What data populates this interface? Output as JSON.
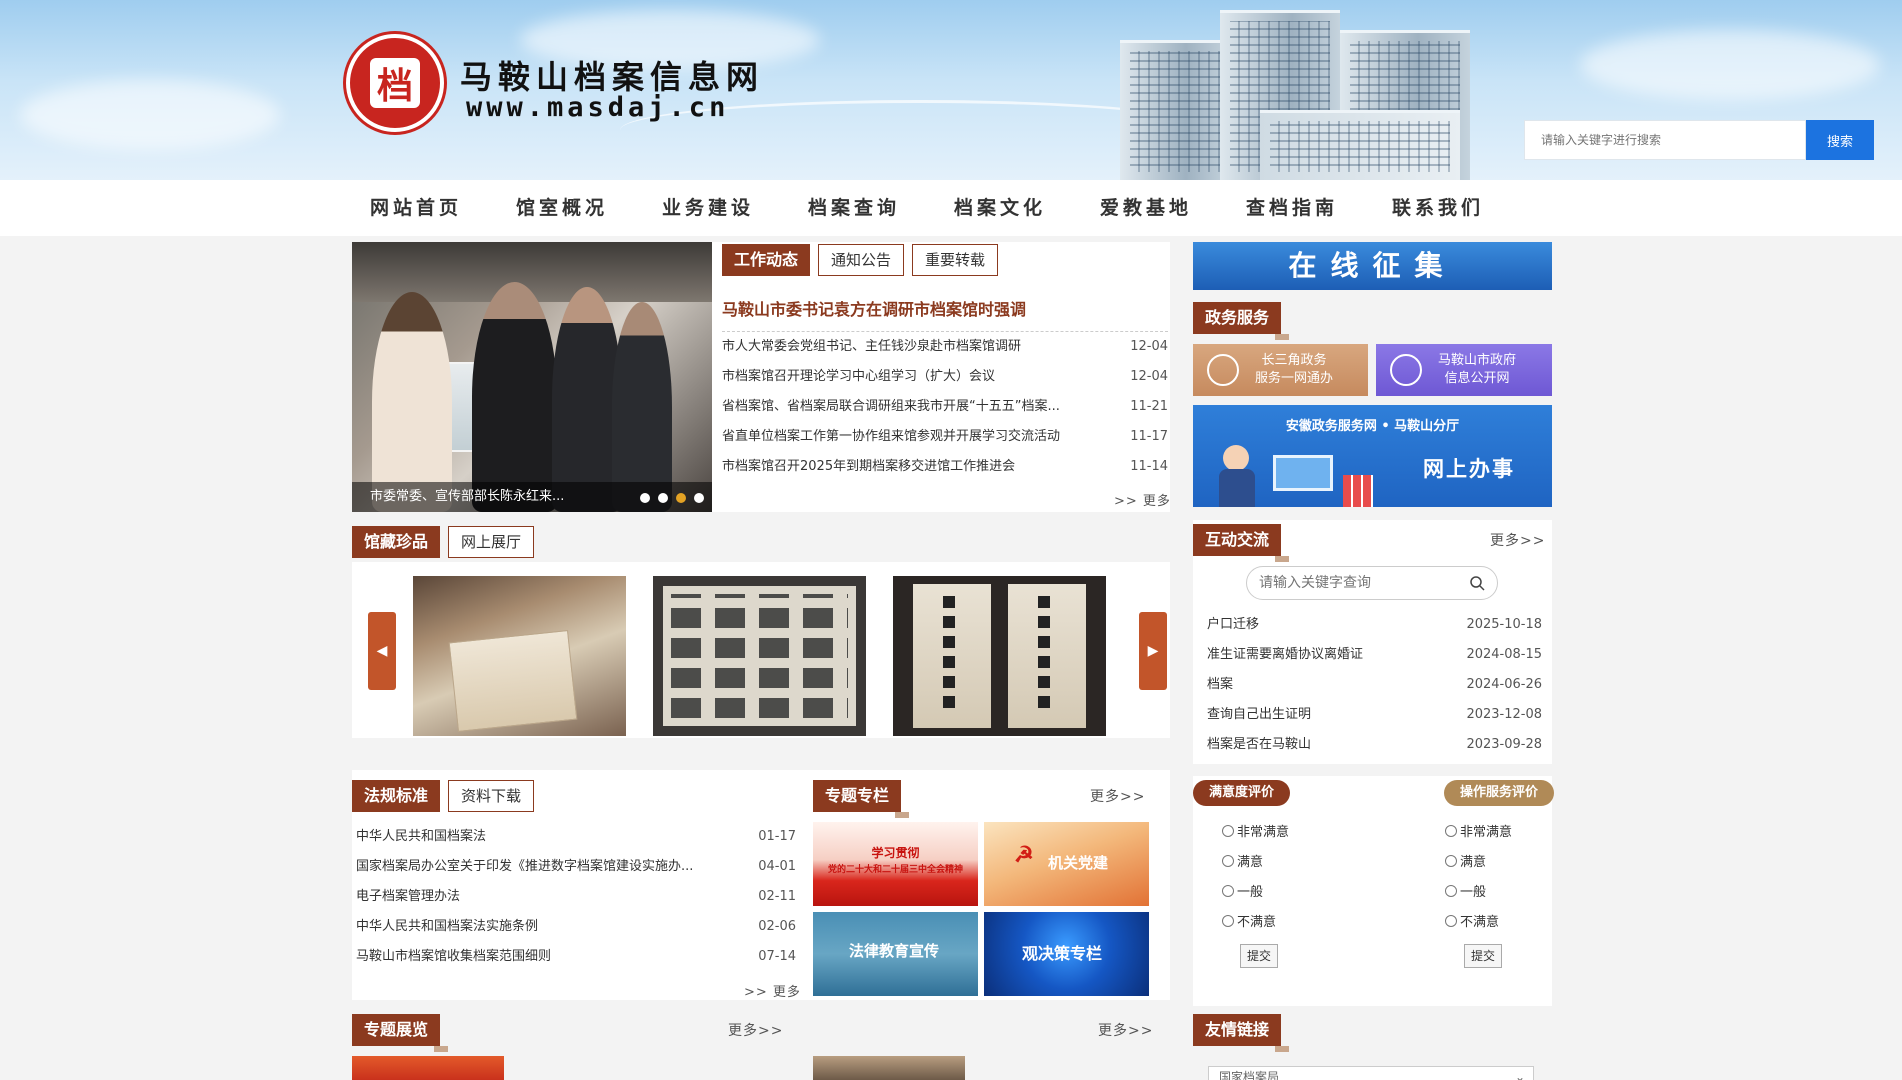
{
  "header": {
    "logo_char": "档",
    "site_title": "马鞍山档案信息网",
    "site_url": "www.masdaj.cn",
    "search_placeholder": "请输入关键字进行搜索",
    "search_button": "搜索"
  },
  "nav": [
    "网站首页",
    "馆室概况",
    "业务建设",
    "档案查询",
    "档案文化",
    "爱教基地",
    "查档指南",
    "联系我们"
  ],
  "carousel": {
    "caption": "市委常委、宣传部部长陈永红来...",
    "dot_count": 4,
    "active_dot": 3
  },
  "news": {
    "tabs": [
      "工作动态",
      "通知公告",
      "重要转载"
    ],
    "headline": "马鞍山市委书记袁方在调研市档案馆时强调",
    "items": [
      {
        "title": "市人大常委会党组书记、主任钱沙泉赴市档案馆调研",
        "date": "12-04"
      },
      {
        "title": "市档案馆召开理论学习中心组学习（扩大）会议",
        "date": "12-04"
      },
      {
        "title": "省档案馆、省档案局联合调研组来我市开展“十五五”档案...",
        "date": "11-21"
      },
      {
        "title": "省直单位档案工作第一协作组来馆参观并开展学习交流活动",
        "date": "11-17"
      },
      {
        "title": "市档案馆召开2025年到期档案移交进馆工作推进会",
        "date": "11-14"
      }
    ],
    "more": ">> 更多"
  },
  "treasures": {
    "tabs": [
      "馆藏珍品",
      "网上展厅"
    ],
    "prev_icon": "◀",
    "next_icon": "▶"
  },
  "right": {
    "collect_banner": "在线征集",
    "gov_title": "政务服务",
    "gov_btn1": [
      "长三角政务",
      "服务一网通办"
    ],
    "gov_btn2": [
      "马鞍山市政府",
      "信息公开网"
    ],
    "online_top": "安徽政务服务网 • 马鞍山分厅",
    "online_main": "网上办事",
    "interact_title": "互动交流",
    "interact_more": "更多>>",
    "interact_placeholder": "请输入关键字查询",
    "interact_items": [
      {
        "title": "户口迁移",
        "date": "2025-10-18"
      },
      {
        "title": "准生证需要离婚协议离婚证",
        "date": "2024-08-15"
      },
      {
        "title": "档案",
        "date": "2024-06-26"
      },
      {
        "title": "查询自己出生证明",
        "date": "2023-12-08"
      },
      {
        "title": "档案是否在马鞍山",
        "date": "2023-09-28"
      }
    ],
    "rating1_title": "满意度评价",
    "rating2_title": "操作服务评价",
    "rating_options": [
      "非常满意",
      "满意",
      "一般",
      "不满意"
    ],
    "submit": "提交",
    "links_title": "友情链接",
    "links_select": "国家档案局"
  },
  "laws": {
    "tabs": [
      "法规标准",
      "资料下载"
    ],
    "items": [
      {
        "title": "中华人民共和国档案法",
        "date": "01-17"
      },
      {
        "title": "国家档案局办公室关于印发《推进数字档案馆建设实施办...",
        "date": "04-01"
      },
      {
        "title": "电子档案管理办法",
        "date": "02-11"
      },
      {
        "title": "中华人民共和国档案法实施条例",
        "date": "02-06"
      },
      {
        "title": "马鞍山市档案馆收集档案范围细则",
        "date": "07-14"
      }
    ],
    "more": ">> 更多"
  },
  "topics": {
    "title": "专题专栏",
    "more": "更多>>",
    "tile1_line1": "学习贯彻",
    "tile1_line2": "党的二十大和二十届三中全会精神",
    "tile2": "机关党建",
    "tile3": "法律教育宣传",
    "tile4": "观决策专栏"
  },
  "exhibit": {
    "title": "专题展览",
    "more1": "更多>>",
    "more2": "更多>>"
  },
  "colors": {
    "brand_brown": "#8b3a1f",
    "accent_blue": "#1c73e0"
  }
}
